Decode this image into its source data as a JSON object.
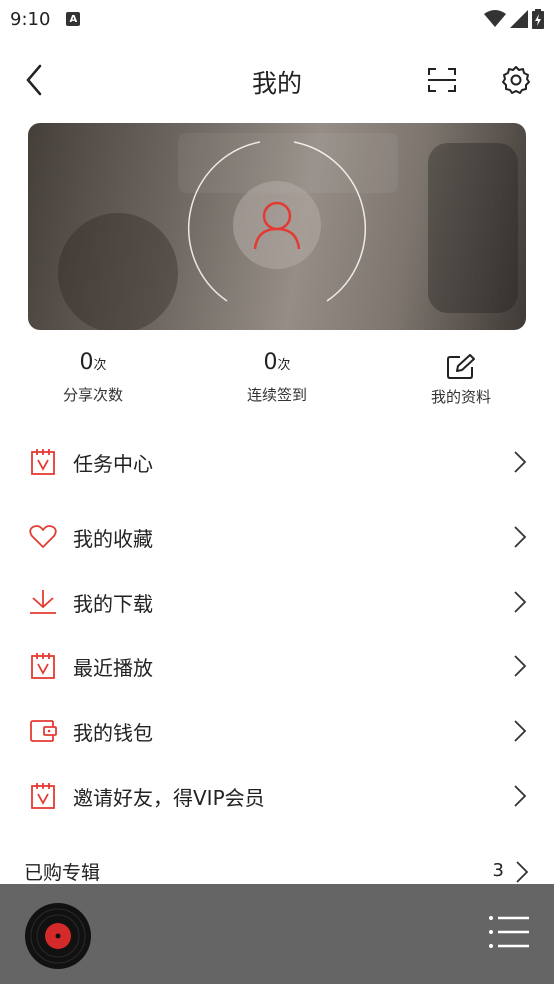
{
  "status_bar": {
    "time": "9:10",
    "notification_glyph": "A"
  },
  "header": {
    "title": "我的"
  },
  "stats": [
    {
      "value": "0",
      "unit": "次",
      "label": "分享次数"
    },
    {
      "value": "0",
      "unit": "次",
      "label": "连续签到"
    },
    {
      "label": "我的资料"
    }
  ],
  "menu": [
    {
      "label": "任务中心",
      "icon": "calendar-icon"
    },
    {
      "label": "我的收藏",
      "icon": "heart-icon"
    },
    {
      "label": "我的下载",
      "icon": "download-icon"
    },
    {
      "label": "最近播放",
      "icon": "calendar-icon"
    },
    {
      "label": "我的钱包",
      "icon": "wallet-icon"
    },
    {
      "label": "邀请好友，得VIP会员",
      "icon": "calendar-icon"
    }
  ],
  "purchased": {
    "label": "已购专辑",
    "count": "3"
  },
  "colors": {
    "accent": "#e33b33",
    "player_bg": "#656565"
  }
}
